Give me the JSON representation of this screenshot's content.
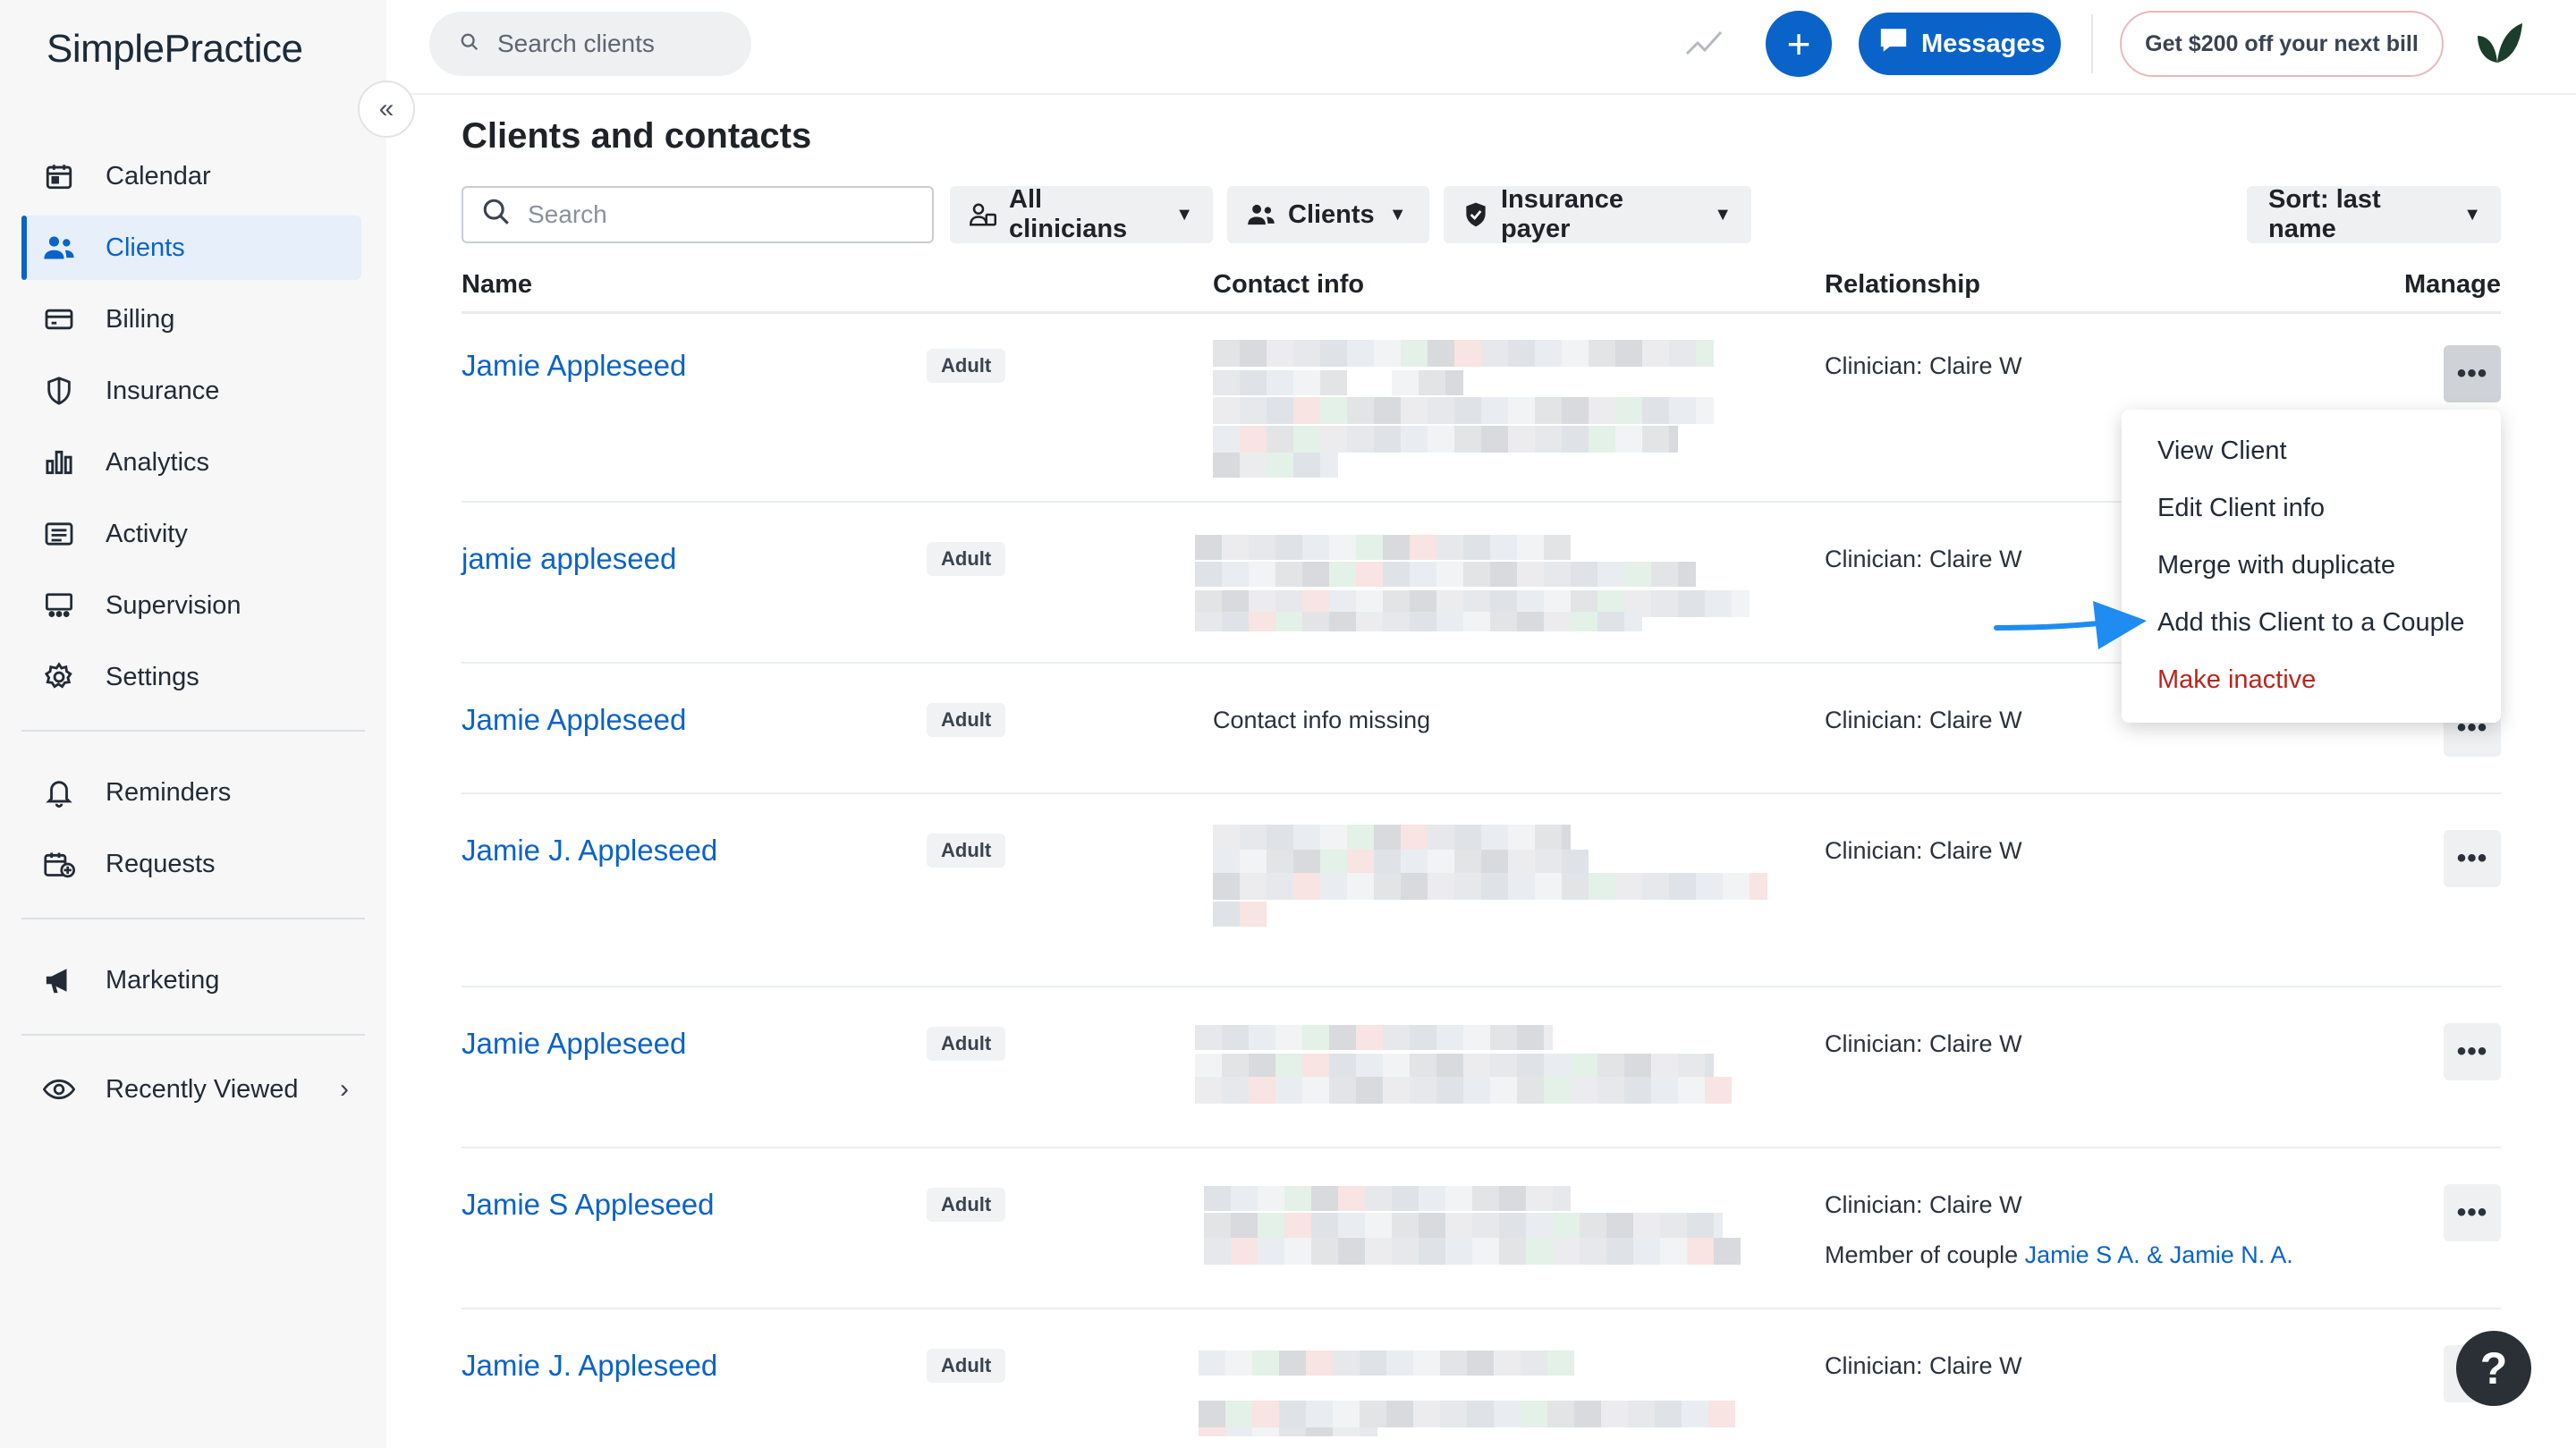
{
  "app": {
    "logo": "SimplePractice"
  },
  "sidebar": {
    "items": [
      {
        "label": "Calendar",
        "icon": "calendar-icon",
        "active": false
      },
      {
        "label": "Clients",
        "icon": "users-icon",
        "active": true
      },
      {
        "label": "Billing",
        "icon": "credit-card-icon",
        "active": false
      },
      {
        "label": "Insurance",
        "icon": "shield-icon",
        "active": false
      },
      {
        "label": "Analytics",
        "icon": "bar-chart-icon",
        "active": false
      },
      {
        "label": "Activity",
        "icon": "list-icon",
        "active": false
      },
      {
        "label": "Supervision",
        "icon": "supervision-icon",
        "active": false
      },
      {
        "label": "Settings",
        "icon": "gear-icon",
        "active": false
      },
      {
        "label": "Reminders",
        "icon": "bell-icon",
        "active": false
      },
      {
        "label": "Requests",
        "icon": "calendar-plus-icon",
        "active": false
      },
      {
        "label": "Marketing",
        "icon": "megaphone-icon",
        "active": false
      },
      {
        "label": "Recently Viewed",
        "icon": "eye-icon",
        "active": false
      }
    ]
  },
  "topbar": {
    "search_placeholder": "Search clients",
    "messages_label": "Messages",
    "promo_label": "Get $200 off your next bill"
  },
  "main": {
    "title": "Clients and contacts",
    "search_placeholder": "Search",
    "filters": {
      "clinicians": "All clinicians",
      "clients": "Clients",
      "insurance": "Insurance payer",
      "sort": "Sort: last name"
    },
    "columns": {
      "name": "Name",
      "contact": "Contact info",
      "relationship": "Relationship",
      "manage": "Manage"
    },
    "rows": [
      {
        "name": "Jamie Appleseed",
        "badge": "Adult",
        "relationship": "Clinician: Claire W"
      },
      {
        "name": "jamie appleseed",
        "badge": "Adult",
        "relationship": "Clinician: Claire W"
      },
      {
        "name": "Jamie Appleseed",
        "badge": "Adult",
        "contact": "Contact info missing",
        "relationship": "Clinician: Claire W"
      },
      {
        "name": "Jamie J. Appleseed",
        "badge": "Adult",
        "relationship": "Clinician: Claire W"
      },
      {
        "name": "Jamie Appleseed",
        "badge": "Adult",
        "relationship": "Clinician: Claire W"
      },
      {
        "name": "Jamie S Appleseed",
        "badge": "Adult",
        "relationship": "Clinician: Claire W",
        "couple_prefix": "Member of couple",
        "couple_link": "Jamie S A. & Jamie N. A."
      },
      {
        "name": "Jamie J. Appleseed",
        "badge": "Adult",
        "relationship": "Clinician: Claire W"
      }
    ],
    "manage_symbol": "•••"
  },
  "menu": {
    "items": [
      "View Client",
      "Edit Client info",
      "Merge with duplicate",
      "Add this Client to a Couple",
      "Make inactive"
    ]
  },
  "colors": {
    "accent": "#0a63c9",
    "danger": "#b8261c",
    "sidebar_bg": "#f7f7f8"
  }
}
